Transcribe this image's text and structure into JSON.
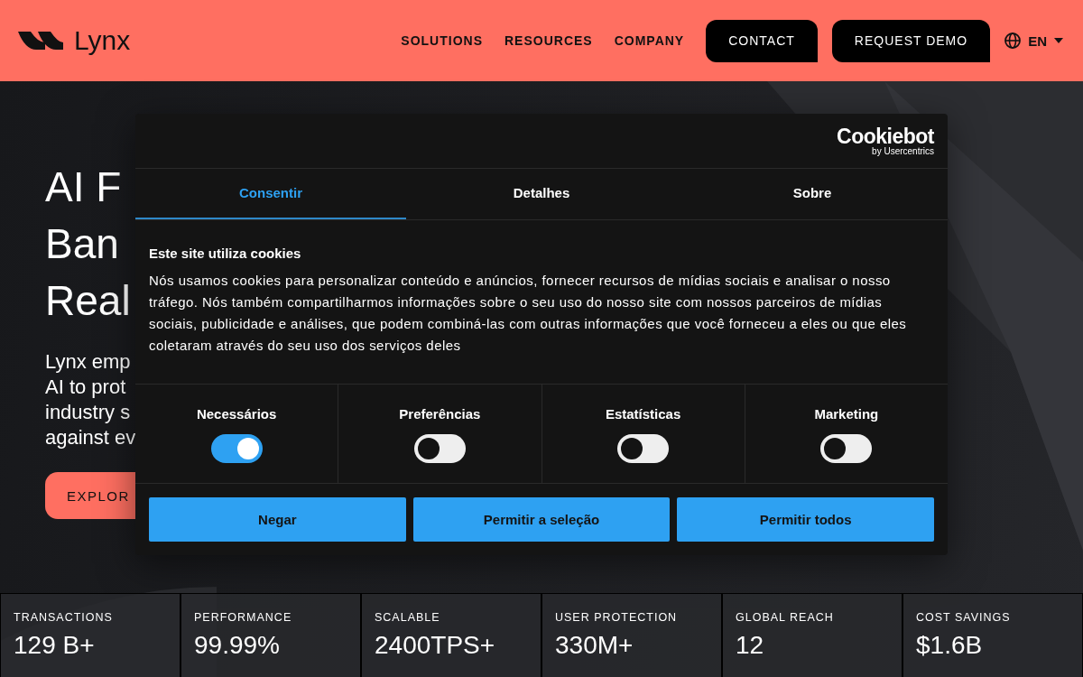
{
  "header": {
    "logo": "Lynx",
    "nav": [
      "SOLUTIONS",
      "RESOURCES",
      "COMPANY"
    ],
    "buttons": [
      {
        "label": "CONTACT"
      },
      {
        "label": "REQUEST DEMO"
      }
    ],
    "language": "EN"
  },
  "hero": {
    "heading": [
      "AI F",
      "Ban",
      "Real"
    ],
    "text": [
      "Lynx emp",
      "AI to prot",
      "industry s",
      "against ev"
    ],
    "button": "EXPLOR"
  },
  "cookie_dialog": {
    "brand": "Cookiebot",
    "brand_sub": "by Usercentrics",
    "tabs": [
      {
        "label": "Consentir",
        "selected": true
      },
      {
        "label": "Detalhes",
        "selected": false
      },
      {
        "label": "Sobre",
        "selected": false
      }
    ],
    "title": "Este site utiliza cookies",
    "body": "Nós usamos cookies para personalizar conteúdo e anúncios, fornecer recursos de mídias sociais e analisar o nosso tráfego. Nós também compartilharmos informações sobre o seu uso do nosso site com nossos parceiros de mídias sociais, publicidade e análises, que podem combiná-las com outras informações que você forneceu a eles ou que eles coletaram através do seu uso dos serviços deles",
    "categories": [
      {
        "label": "Necessários",
        "on": true
      },
      {
        "label": "Preferências",
        "on": false
      },
      {
        "label": "Estatísticas",
        "on": false
      },
      {
        "label": "Marketing",
        "on": false
      }
    ],
    "buttons": [
      "Negar",
      "Permitir a seleção",
      "Permitir todos"
    ]
  },
  "stats": [
    {
      "label": "TRANSACTIONS",
      "value": "129 B+"
    },
    {
      "label": "PERFORMANCE",
      "value": "99.99%"
    },
    {
      "label": "SCALABLE",
      "value": "2400TPS+"
    },
    {
      "label": "USER PROTECTION",
      "value": "330M+"
    },
    {
      "label": "GLOBAL REACH",
      "value": "12"
    },
    {
      "label": "COST SAVINGS",
      "value": "$1.6B"
    }
  ]
}
